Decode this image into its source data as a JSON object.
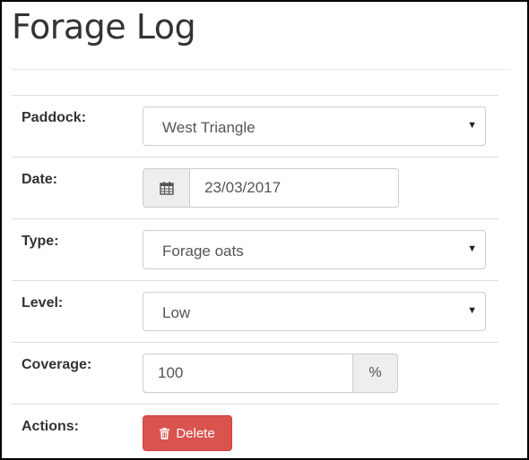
{
  "page": {
    "title": "Forage Log"
  },
  "form": {
    "paddock": {
      "label": "Paddock:",
      "value": "West Triangle"
    },
    "date": {
      "label": "Date:",
      "value": "23/03/2017",
      "icon": "calendar-icon"
    },
    "type": {
      "label": "Type:",
      "value": "Forage oats"
    },
    "level": {
      "label": "Level:",
      "value": "Low"
    },
    "coverage": {
      "label": "Coverage:",
      "value": "100",
      "unit": "%"
    },
    "actions": {
      "label": "Actions:",
      "delete_label": "Delete",
      "delete_icon": "trash-icon"
    }
  },
  "colors": {
    "danger": "#d9534f",
    "addon_bg": "#eeeeee",
    "border": "#cccccc"
  }
}
